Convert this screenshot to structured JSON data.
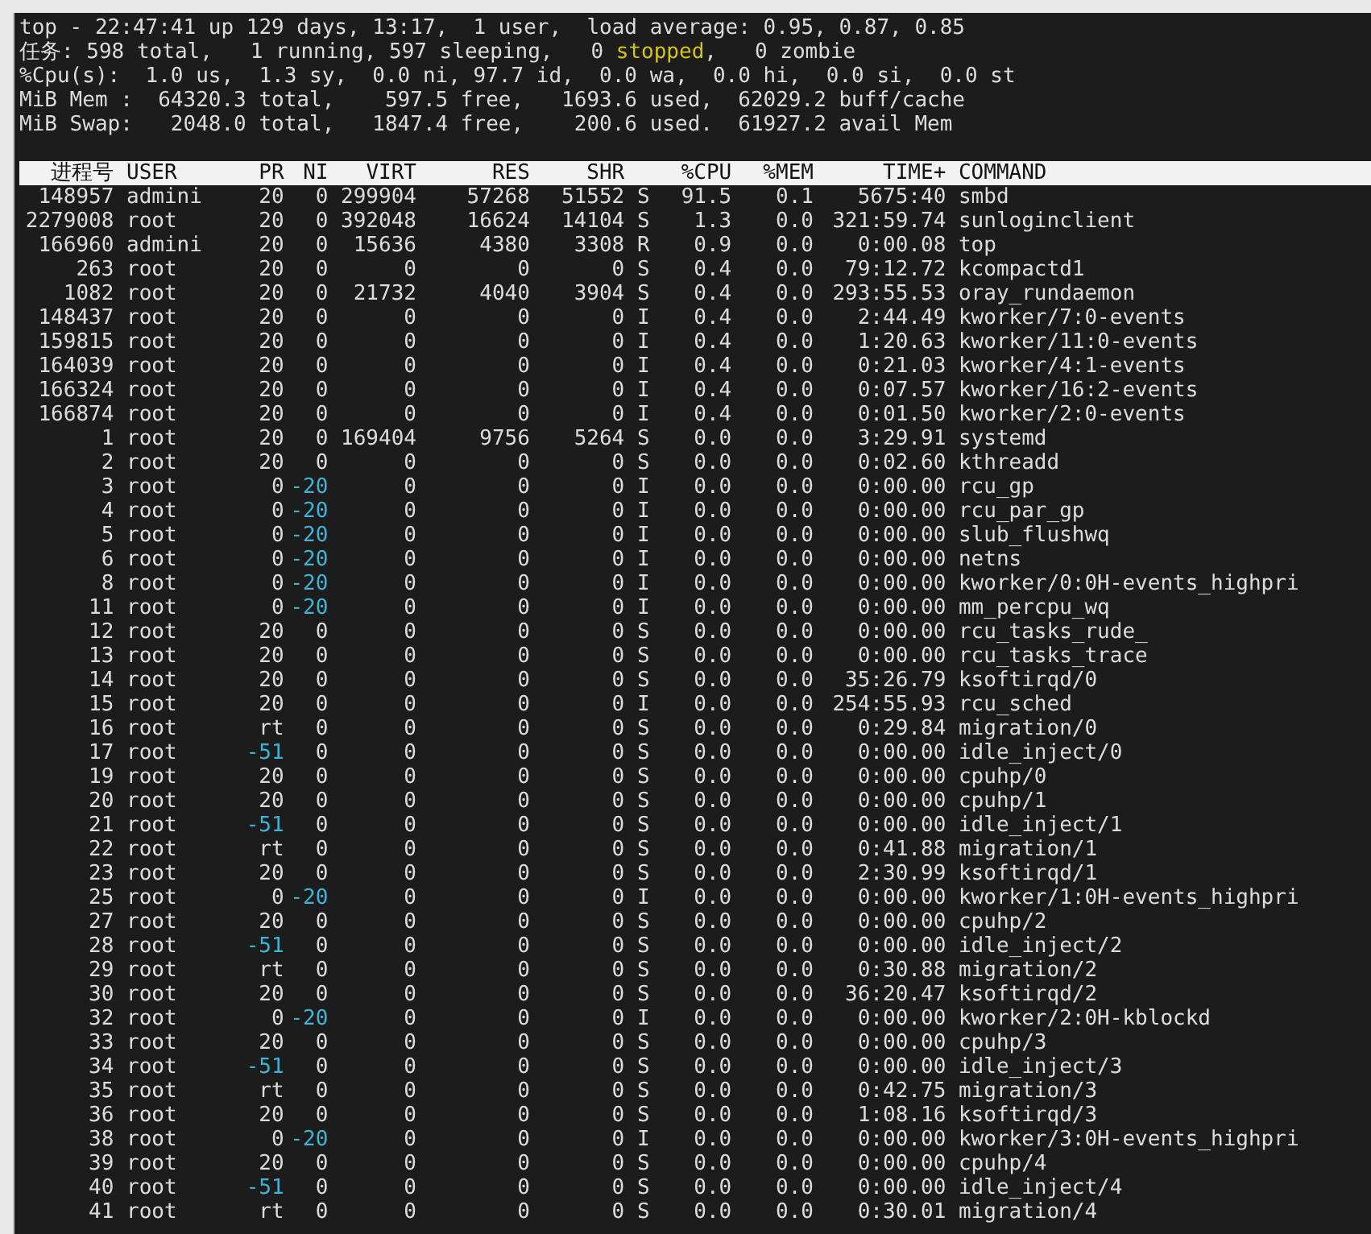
{
  "summary": [
    [
      {
        "text": "top - 22:47:41 up 129 days, 13:17,  1 user,  load average: 0.95, 0.87, 0.85",
        "highlighted": false
      }
    ],
    [
      {
        "text": "任务: 598 total,   1 running, 597 sleeping,   0 ",
        "highlighted": false
      },
      {
        "text": "stopped",
        "highlighted": true
      },
      {
        "text": ",   0 zombie",
        "highlighted": false
      }
    ],
    [
      {
        "text": "%Cpu(s):  1.0 us,  1.3 sy,  0.0 ni, 97.7 id,  0.0 wa,  0.0 hi,  0.0 si,  0.0 st",
        "highlighted": false
      }
    ],
    [
      {
        "text": "MiB Mem :  64320.3 total,    597.5 free,   1693.6 used,  62029.2 buff/cache",
        "highlighted": false
      }
    ],
    [
      {
        "text": "MiB Swap:   2048.0 total,   1847.4 free,    200.6 used.  61927.2 avail Mem",
        "highlighted": false
      }
    ]
  ],
  "table": {
    "columns": [
      "进程号",
      "USER",
      "PR",
      "NI",
      "VIRT",
      "RES",
      "SHR",
      "%CPU",
      "%MEM",
      "TIME+",
      "COMMAND"
    ],
    "rows": [
      {
        "pid": "148957",
        "user": "admini",
        "pr": "20",
        "ni": "0",
        "virt": "299904",
        "res": "57268",
        "shr": "51552",
        "s": "S",
        "cpu": "91.5",
        "mem": "0.1",
        "time": "5675:40",
        "command": "smbd",
        "pr_highlighted": false,
        "ni_highlighted": false
      },
      {
        "pid": "2279008",
        "user": "root",
        "pr": "20",
        "ni": "0",
        "virt": "392048",
        "res": "16624",
        "shr": "14104",
        "s": "S",
        "cpu": "1.3",
        "mem": "0.0",
        "time": "321:59.74",
        "command": "sunloginclient",
        "pr_highlighted": false,
        "ni_highlighted": false
      },
      {
        "pid": "166960",
        "user": "admini",
        "pr": "20",
        "ni": "0",
        "virt": "15636",
        "res": "4380",
        "shr": "3308",
        "s": "R",
        "cpu": "0.9",
        "mem": "0.0",
        "time": "0:00.08",
        "command": "top",
        "pr_highlighted": false,
        "ni_highlighted": false
      },
      {
        "pid": "263",
        "user": "root",
        "pr": "20",
        "ni": "0",
        "virt": "0",
        "res": "0",
        "shr": "0",
        "s": "S",
        "cpu": "0.4",
        "mem": "0.0",
        "time": "79:12.72",
        "command": "kcompactd1",
        "pr_highlighted": false,
        "ni_highlighted": false
      },
      {
        "pid": "1082",
        "user": "root",
        "pr": "20",
        "ni": "0",
        "virt": "21732",
        "res": "4040",
        "shr": "3904",
        "s": "S",
        "cpu": "0.4",
        "mem": "0.0",
        "time": "293:55.53",
        "command": "oray_rundaemon",
        "pr_highlighted": false,
        "ni_highlighted": false
      },
      {
        "pid": "148437",
        "user": "root",
        "pr": "20",
        "ni": "0",
        "virt": "0",
        "res": "0",
        "shr": "0",
        "s": "I",
        "cpu": "0.4",
        "mem": "0.0",
        "time": "2:44.49",
        "command": "kworker/7:0-events",
        "pr_highlighted": false,
        "ni_highlighted": false
      },
      {
        "pid": "159815",
        "user": "root",
        "pr": "20",
        "ni": "0",
        "virt": "0",
        "res": "0",
        "shr": "0",
        "s": "I",
        "cpu": "0.4",
        "mem": "0.0",
        "time": "1:20.63",
        "command": "kworker/11:0-events",
        "pr_highlighted": false,
        "ni_highlighted": false
      },
      {
        "pid": "164039",
        "user": "root",
        "pr": "20",
        "ni": "0",
        "virt": "0",
        "res": "0",
        "shr": "0",
        "s": "I",
        "cpu": "0.4",
        "mem": "0.0",
        "time": "0:21.03",
        "command": "kworker/4:1-events",
        "pr_highlighted": false,
        "ni_highlighted": false
      },
      {
        "pid": "166324",
        "user": "root",
        "pr": "20",
        "ni": "0",
        "virt": "0",
        "res": "0",
        "shr": "0",
        "s": "I",
        "cpu": "0.4",
        "mem": "0.0",
        "time": "0:07.57",
        "command": "kworker/16:2-events",
        "pr_highlighted": false,
        "ni_highlighted": false
      },
      {
        "pid": "166874",
        "user": "root",
        "pr": "20",
        "ni": "0",
        "virt": "0",
        "res": "0",
        "shr": "0",
        "s": "I",
        "cpu": "0.4",
        "mem": "0.0",
        "time": "0:01.50",
        "command": "kworker/2:0-events",
        "pr_highlighted": false,
        "ni_highlighted": false
      },
      {
        "pid": "1",
        "user": "root",
        "pr": "20",
        "ni": "0",
        "virt": "169404",
        "res": "9756",
        "shr": "5264",
        "s": "S",
        "cpu": "0.0",
        "mem": "0.0",
        "time": "3:29.91",
        "command": "systemd",
        "pr_highlighted": false,
        "ni_highlighted": false
      },
      {
        "pid": "2",
        "user": "root",
        "pr": "20",
        "ni": "0",
        "virt": "0",
        "res": "0",
        "shr": "0",
        "s": "S",
        "cpu": "0.0",
        "mem": "0.0",
        "time": "0:02.60",
        "command": "kthreadd",
        "pr_highlighted": false,
        "ni_highlighted": false
      },
      {
        "pid": "3",
        "user": "root",
        "pr": "0",
        "ni": "-20",
        "virt": "0",
        "res": "0",
        "shr": "0",
        "s": "I",
        "cpu": "0.0",
        "mem": "0.0",
        "time": "0:00.00",
        "command": "rcu_gp",
        "pr_highlighted": false,
        "ni_highlighted": true
      },
      {
        "pid": "4",
        "user": "root",
        "pr": "0",
        "ni": "-20",
        "virt": "0",
        "res": "0",
        "shr": "0",
        "s": "I",
        "cpu": "0.0",
        "mem": "0.0",
        "time": "0:00.00",
        "command": "rcu_par_gp",
        "pr_highlighted": false,
        "ni_highlighted": true
      },
      {
        "pid": "5",
        "user": "root",
        "pr": "0",
        "ni": "-20",
        "virt": "0",
        "res": "0",
        "shr": "0",
        "s": "I",
        "cpu": "0.0",
        "mem": "0.0",
        "time": "0:00.00",
        "command": "slub_flushwq",
        "pr_highlighted": false,
        "ni_highlighted": true
      },
      {
        "pid": "6",
        "user": "root",
        "pr": "0",
        "ni": "-20",
        "virt": "0",
        "res": "0",
        "shr": "0",
        "s": "I",
        "cpu": "0.0",
        "mem": "0.0",
        "time": "0:00.00",
        "command": "netns",
        "pr_highlighted": false,
        "ni_highlighted": true
      },
      {
        "pid": "8",
        "user": "root",
        "pr": "0",
        "ni": "-20",
        "virt": "0",
        "res": "0",
        "shr": "0",
        "s": "I",
        "cpu": "0.0",
        "mem": "0.0",
        "time": "0:00.00",
        "command": "kworker/0:0H-events_highpri",
        "pr_highlighted": false,
        "ni_highlighted": true
      },
      {
        "pid": "11",
        "user": "root",
        "pr": "0",
        "ni": "-20",
        "virt": "0",
        "res": "0",
        "shr": "0",
        "s": "I",
        "cpu": "0.0",
        "mem": "0.0",
        "time": "0:00.00",
        "command": "mm_percpu_wq",
        "pr_highlighted": false,
        "ni_highlighted": true
      },
      {
        "pid": "12",
        "user": "root",
        "pr": "20",
        "ni": "0",
        "virt": "0",
        "res": "0",
        "shr": "0",
        "s": "S",
        "cpu": "0.0",
        "mem": "0.0",
        "time": "0:00.00",
        "command": "rcu_tasks_rude_",
        "pr_highlighted": false,
        "ni_highlighted": false
      },
      {
        "pid": "13",
        "user": "root",
        "pr": "20",
        "ni": "0",
        "virt": "0",
        "res": "0",
        "shr": "0",
        "s": "S",
        "cpu": "0.0",
        "mem": "0.0",
        "time": "0:00.00",
        "command": "rcu_tasks_trace",
        "pr_highlighted": false,
        "ni_highlighted": false
      },
      {
        "pid": "14",
        "user": "root",
        "pr": "20",
        "ni": "0",
        "virt": "0",
        "res": "0",
        "shr": "0",
        "s": "S",
        "cpu": "0.0",
        "mem": "0.0",
        "time": "35:26.79",
        "command": "ksoftirqd/0",
        "pr_highlighted": false,
        "ni_highlighted": false
      },
      {
        "pid": "15",
        "user": "root",
        "pr": "20",
        "ni": "0",
        "virt": "0",
        "res": "0",
        "shr": "0",
        "s": "I",
        "cpu": "0.0",
        "mem": "0.0",
        "time": "254:55.93",
        "command": "rcu_sched",
        "pr_highlighted": false,
        "ni_highlighted": false
      },
      {
        "pid": "16",
        "user": "root",
        "pr": "rt",
        "ni": "0",
        "virt": "0",
        "res": "0",
        "shr": "0",
        "s": "S",
        "cpu": "0.0",
        "mem": "0.0",
        "time": "0:29.84",
        "command": "migration/0",
        "pr_highlighted": false,
        "ni_highlighted": false
      },
      {
        "pid": "17",
        "user": "root",
        "pr": "-51",
        "ni": "0",
        "virt": "0",
        "res": "0",
        "shr": "0",
        "s": "S",
        "cpu": "0.0",
        "mem": "0.0",
        "time": "0:00.00",
        "command": "idle_inject/0",
        "pr_highlighted": true,
        "ni_highlighted": false
      },
      {
        "pid": "19",
        "user": "root",
        "pr": "20",
        "ni": "0",
        "virt": "0",
        "res": "0",
        "shr": "0",
        "s": "S",
        "cpu": "0.0",
        "mem": "0.0",
        "time": "0:00.00",
        "command": "cpuhp/0",
        "pr_highlighted": false,
        "ni_highlighted": false
      },
      {
        "pid": "20",
        "user": "root",
        "pr": "20",
        "ni": "0",
        "virt": "0",
        "res": "0",
        "shr": "0",
        "s": "S",
        "cpu": "0.0",
        "mem": "0.0",
        "time": "0:00.00",
        "command": "cpuhp/1",
        "pr_highlighted": false,
        "ni_highlighted": false
      },
      {
        "pid": "21",
        "user": "root",
        "pr": "-51",
        "ni": "0",
        "virt": "0",
        "res": "0",
        "shr": "0",
        "s": "S",
        "cpu": "0.0",
        "mem": "0.0",
        "time": "0:00.00",
        "command": "idle_inject/1",
        "pr_highlighted": true,
        "ni_highlighted": false
      },
      {
        "pid": "22",
        "user": "root",
        "pr": "rt",
        "ni": "0",
        "virt": "0",
        "res": "0",
        "shr": "0",
        "s": "S",
        "cpu": "0.0",
        "mem": "0.0",
        "time": "0:41.88",
        "command": "migration/1",
        "pr_highlighted": false,
        "ni_highlighted": false
      },
      {
        "pid": "23",
        "user": "root",
        "pr": "20",
        "ni": "0",
        "virt": "0",
        "res": "0",
        "shr": "0",
        "s": "S",
        "cpu": "0.0",
        "mem": "0.0",
        "time": "2:30.99",
        "command": "ksoftirqd/1",
        "pr_highlighted": false,
        "ni_highlighted": false
      },
      {
        "pid": "25",
        "user": "root",
        "pr": "0",
        "ni": "-20",
        "virt": "0",
        "res": "0",
        "shr": "0",
        "s": "I",
        "cpu": "0.0",
        "mem": "0.0",
        "time": "0:00.00",
        "command": "kworker/1:0H-events_highpri",
        "pr_highlighted": false,
        "ni_highlighted": true
      },
      {
        "pid": "27",
        "user": "root",
        "pr": "20",
        "ni": "0",
        "virt": "0",
        "res": "0",
        "shr": "0",
        "s": "S",
        "cpu": "0.0",
        "mem": "0.0",
        "time": "0:00.00",
        "command": "cpuhp/2",
        "pr_highlighted": false,
        "ni_highlighted": false
      },
      {
        "pid": "28",
        "user": "root",
        "pr": "-51",
        "ni": "0",
        "virt": "0",
        "res": "0",
        "shr": "0",
        "s": "S",
        "cpu": "0.0",
        "mem": "0.0",
        "time": "0:00.00",
        "command": "idle_inject/2",
        "pr_highlighted": true,
        "ni_highlighted": false
      },
      {
        "pid": "29",
        "user": "root",
        "pr": "rt",
        "ni": "0",
        "virt": "0",
        "res": "0",
        "shr": "0",
        "s": "S",
        "cpu": "0.0",
        "mem": "0.0",
        "time": "0:30.88",
        "command": "migration/2",
        "pr_highlighted": false,
        "ni_highlighted": false
      },
      {
        "pid": "30",
        "user": "root",
        "pr": "20",
        "ni": "0",
        "virt": "0",
        "res": "0",
        "shr": "0",
        "s": "S",
        "cpu": "0.0",
        "mem": "0.0",
        "time": "36:20.47",
        "command": "ksoftirqd/2",
        "pr_highlighted": false,
        "ni_highlighted": false
      },
      {
        "pid": "32",
        "user": "root",
        "pr": "0",
        "ni": "-20",
        "virt": "0",
        "res": "0",
        "shr": "0",
        "s": "I",
        "cpu": "0.0",
        "mem": "0.0",
        "time": "0:00.00",
        "command": "kworker/2:0H-kblockd",
        "pr_highlighted": false,
        "ni_highlighted": true
      },
      {
        "pid": "33",
        "user": "root",
        "pr": "20",
        "ni": "0",
        "virt": "0",
        "res": "0",
        "shr": "0",
        "s": "S",
        "cpu": "0.0",
        "mem": "0.0",
        "time": "0:00.00",
        "command": "cpuhp/3",
        "pr_highlighted": false,
        "ni_highlighted": false
      },
      {
        "pid": "34",
        "user": "root",
        "pr": "-51",
        "ni": "0",
        "virt": "0",
        "res": "0",
        "shr": "0",
        "s": "S",
        "cpu": "0.0",
        "mem": "0.0",
        "time": "0:00.00",
        "command": "idle_inject/3",
        "pr_highlighted": true,
        "ni_highlighted": false
      },
      {
        "pid": "35",
        "user": "root",
        "pr": "rt",
        "ni": "0",
        "virt": "0",
        "res": "0",
        "shr": "0",
        "s": "S",
        "cpu": "0.0",
        "mem": "0.0",
        "time": "0:42.75",
        "command": "migration/3",
        "pr_highlighted": false,
        "ni_highlighted": false
      },
      {
        "pid": "36",
        "user": "root",
        "pr": "20",
        "ni": "0",
        "virt": "0",
        "res": "0",
        "shr": "0",
        "s": "S",
        "cpu": "0.0",
        "mem": "0.0",
        "time": "1:08.16",
        "command": "ksoftirqd/3",
        "pr_highlighted": false,
        "ni_highlighted": false
      },
      {
        "pid": "38",
        "user": "root",
        "pr": "0",
        "ni": "-20",
        "virt": "0",
        "res": "0",
        "shr": "0",
        "s": "I",
        "cpu": "0.0",
        "mem": "0.0",
        "time": "0:00.00",
        "command": "kworker/3:0H-events_highpri",
        "pr_highlighted": false,
        "ni_highlighted": true
      },
      {
        "pid": "39",
        "user": "root",
        "pr": "20",
        "ni": "0",
        "virt": "0",
        "res": "0",
        "shr": "0",
        "s": "S",
        "cpu": "0.0",
        "mem": "0.0",
        "time": "0:00.00",
        "command": "cpuhp/4",
        "pr_highlighted": false,
        "ni_highlighted": false
      },
      {
        "pid": "40",
        "user": "root",
        "pr": "-51",
        "ni": "0",
        "virt": "0",
        "res": "0",
        "shr": "0",
        "s": "S",
        "cpu": "0.0",
        "mem": "0.0",
        "time": "0:00.00",
        "command": "idle_inject/4",
        "pr_highlighted": true,
        "ni_highlighted": false
      },
      {
        "pid": "41",
        "user": "root",
        "pr": "rt",
        "ni": "0",
        "virt": "0",
        "res": "0",
        "shr": "0",
        "s": "S",
        "cpu": "0.0",
        "mem": "0.0",
        "time": "0:30.01",
        "command": "migration/4",
        "pr_highlighted": false,
        "ni_highlighted": false
      }
    ]
  }
}
